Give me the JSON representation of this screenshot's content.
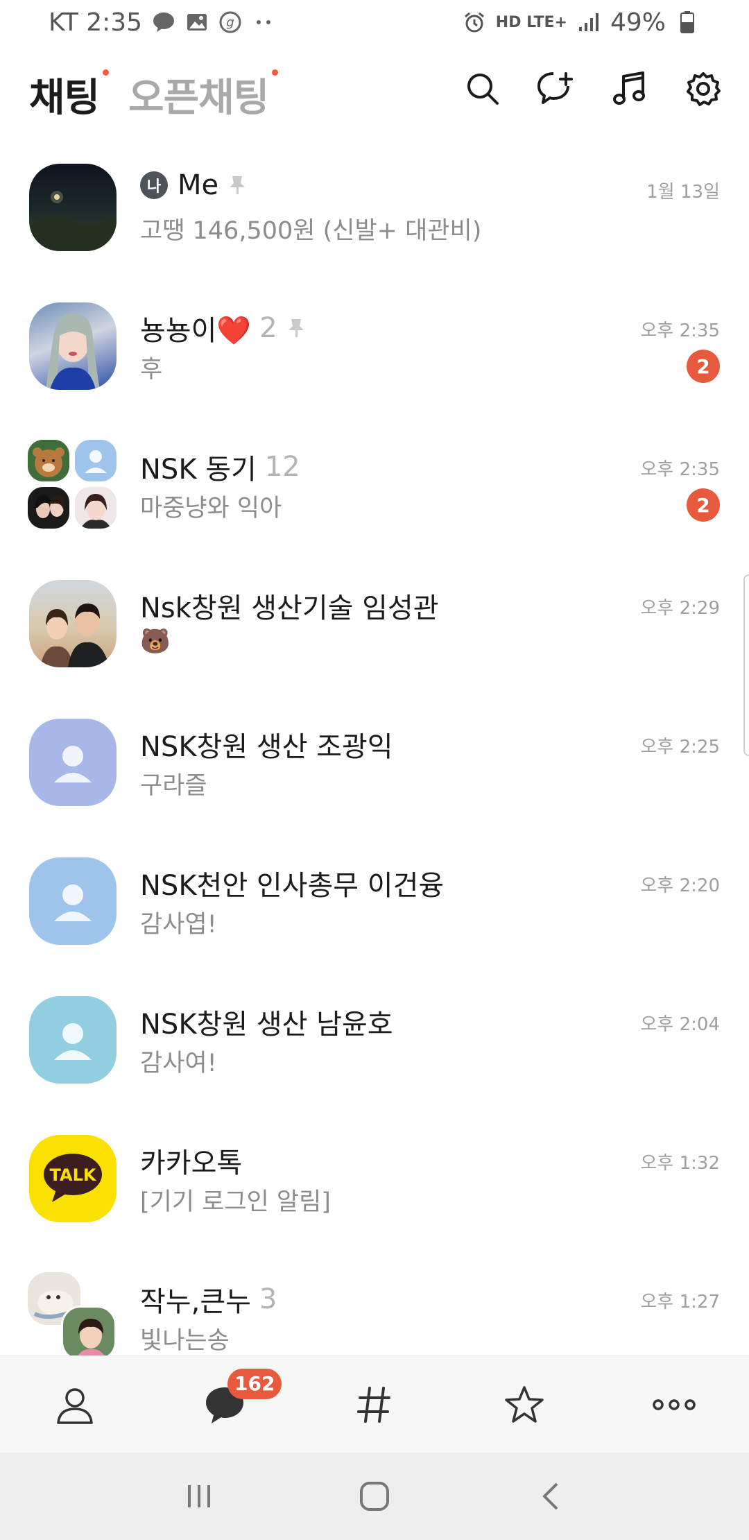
{
  "status_bar": {
    "carrier_time": "KT 2:35",
    "network": "HD LTE+",
    "battery": "49%"
  },
  "header": {
    "tab_chats": "채팅",
    "tab_open_chats": "오픈채팅",
    "icons": [
      "search-icon",
      "new-chat-icon",
      "music-icon",
      "settings-icon"
    ]
  },
  "chats": [
    {
      "badge": "나",
      "name": "Me",
      "preview": "고땡 146,500원 (신발+ 대관비)",
      "time": "1월 13일",
      "pinned": true
    },
    {
      "name": "뇽뇽이❤️",
      "count": "2",
      "preview": "후",
      "time": "오후 2:35",
      "unread": "2",
      "pinned": true
    },
    {
      "name": "NSK 동기",
      "count": "12",
      "preview": "마중냥와 익아",
      "time": "오후 2:35",
      "unread": "2"
    },
    {
      "name": "Nsk창원 생산기술 임성관",
      "preview": "🐻",
      "time": "오후 2:29"
    },
    {
      "name": "NSK창원 생산 조광익",
      "preview": "구라즐",
      "time": "오후 2:25"
    },
    {
      "name": "NSK천안 인사총무 이건융",
      "preview": "감사엽!",
      "time": "오후 2:20"
    },
    {
      "name": "NSK창원 생산 남윤호",
      "preview": "감사여!",
      "time": "오후 2:04"
    },
    {
      "name": "카카오톡",
      "preview": "[기기 로그인 알림]",
      "time": "오후 1:32",
      "avatar_text": "TALK"
    },
    {
      "name": "작누,큰누",
      "count": "3",
      "preview": "빛나는송",
      "time": "오후 1:27"
    }
  ],
  "bottom_nav": {
    "items": [
      "friends-icon",
      "chats-icon",
      "hashtag-icon",
      "star-icon",
      "more-icon"
    ],
    "chats_badge": "162"
  },
  "colors": {
    "accent_red": "#e85a3d",
    "kakao_yellow": "#fae100"
  }
}
